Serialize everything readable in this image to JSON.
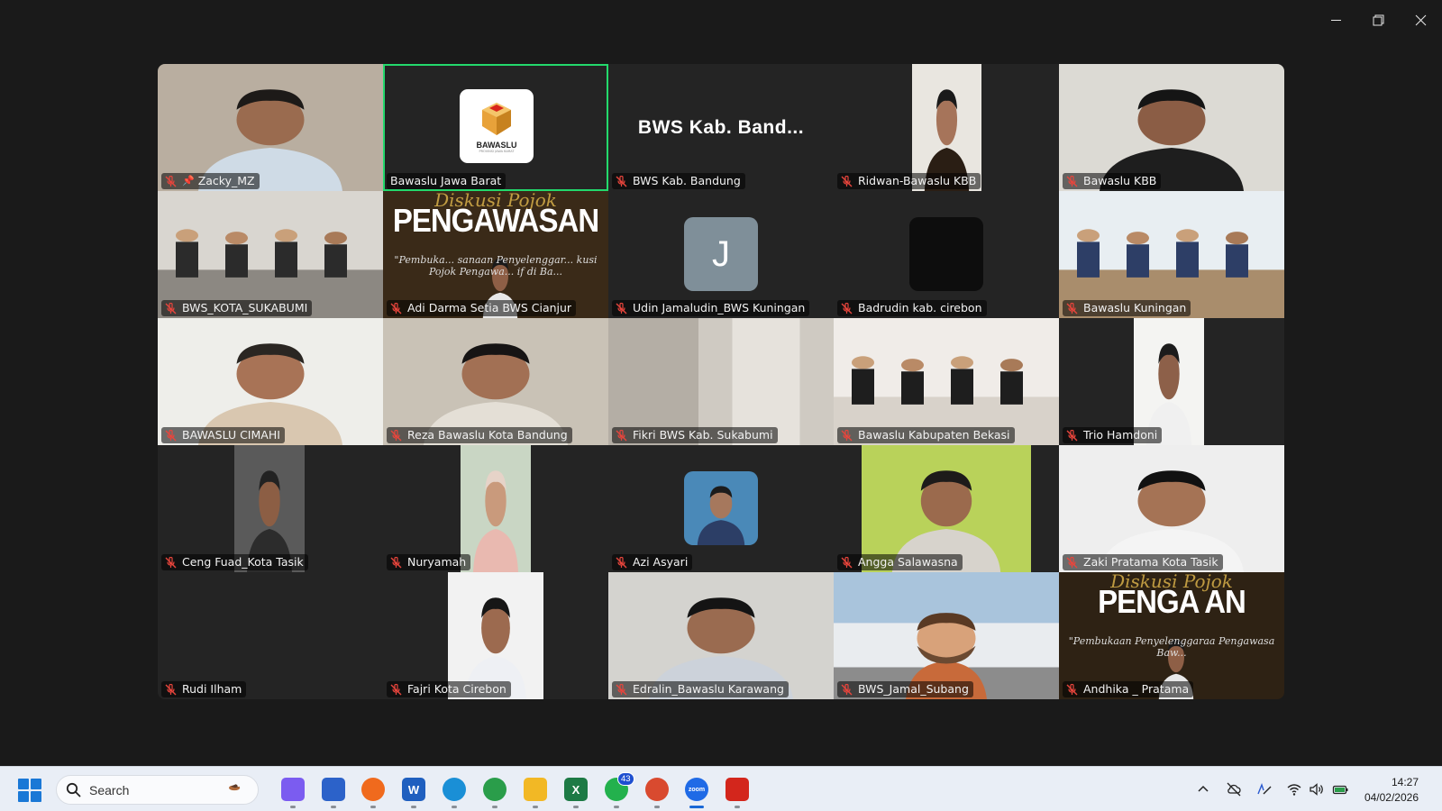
{
  "window": {
    "controls": [
      "minimize",
      "restore",
      "close"
    ]
  },
  "participants": [
    {
      "name": "Zacky_MZ",
      "muted": true,
      "pinned": true
    },
    {
      "name": "Bawaslu Jawa Barat",
      "muted": false,
      "active_speaker": true,
      "logo_text": "BAWASLU",
      "logo_sub": "PROVINSI JAWA BARAT"
    },
    {
      "name": "BWS Kab. Bandung",
      "muted": true,
      "display_name": "BWS Kab. Band..."
    },
    {
      "name": "Ridwan-Bawaslu KBB",
      "muted": true
    },
    {
      "name": "Bawaslu KBB",
      "muted": true
    },
    {
      "name": "BWS_KOTA_SUKABUMI",
      "muted": true
    },
    {
      "name": "Adi Darma Setia BWS Cianjur",
      "muted": true,
      "banner_script": "Diskusi Pojok",
      "banner_title": "PENGAWASAN",
      "banner_sub": "\"Pembuka... sanaan Penyelenggar... kusi Pojok Pengawa... if di Ba..."
    },
    {
      "name": "Udin Jamaludin_BWS Kuningan",
      "muted": true,
      "avatar_initial": "J"
    },
    {
      "name": "Badrudin kab. cirebon",
      "muted": true
    },
    {
      "name": "Bawaslu Kuningan",
      "muted": true
    },
    {
      "name": "BAWASLU CIMAHI",
      "muted": true
    },
    {
      "name": "Reza Bawaslu Kota Bandung",
      "muted": true
    },
    {
      "name": "Fikri BWS Kab. Sukabumi",
      "muted": true
    },
    {
      "name": "Bawaslu Kabupaten Bekasi",
      "muted": true
    },
    {
      "name": "Trio Hamdoni",
      "muted": true
    },
    {
      "name": "Ceng Fuad_Kota Tasik",
      "muted": true
    },
    {
      "name": "Nuryamah",
      "muted": true
    },
    {
      "name": "Azi Asyari",
      "muted": true
    },
    {
      "name": "Angga Salawasna",
      "muted": true
    },
    {
      "name": "Zaki Pratama Kota Tasik",
      "muted": true
    },
    {
      "name": "Rudi Ilham",
      "muted": true
    },
    {
      "name": "Fajri Kota Cirebon",
      "muted": true
    },
    {
      "name": "Edralin_Bawaslu Karawang",
      "muted": true
    },
    {
      "name": "BWS_Jamal_Subang",
      "muted": true
    },
    {
      "name": "Andhika _ Pratama",
      "muted": true,
      "banner_script": "Diskusi Pojok",
      "banner_title": "PENGA      AN",
      "banner_sub": "\"Pembukaan Penyelenggaraa Pengawasa Baw..."
    }
  ],
  "taskbar": {
    "search_placeholder": "Search",
    "apps": [
      {
        "name": "copilot",
        "color": "#7b5cf0"
      },
      {
        "name": "microsoft-store",
        "color": "#2c62c9"
      },
      {
        "name": "firefox",
        "color": "#f06a1d"
      },
      {
        "name": "word",
        "color": "#1f5fbf",
        "label": "W"
      },
      {
        "name": "edge",
        "color": "#1a8fd6"
      },
      {
        "name": "chrome",
        "color": "#2a9d4a"
      },
      {
        "name": "file-explorer",
        "color": "#f2b825"
      },
      {
        "name": "excel",
        "color": "#1d7a45",
        "label": "X"
      },
      {
        "name": "whatsapp",
        "color": "#23b14d",
        "badge": "43"
      },
      {
        "name": "chrome-profile",
        "color": "#d94a2f"
      },
      {
        "name": "zoom",
        "color": "#1f6ae6",
        "label": "zoom",
        "active": true
      },
      {
        "name": "acrobat",
        "color": "#d3261c"
      }
    ],
    "time": "14:27",
    "date": "04/02/2026"
  },
  "colors": {
    "active_speaker_border": "#23d96c",
    "mute_icon": "#e8453c",
    "background": "#1a1a1a"
  }
}
